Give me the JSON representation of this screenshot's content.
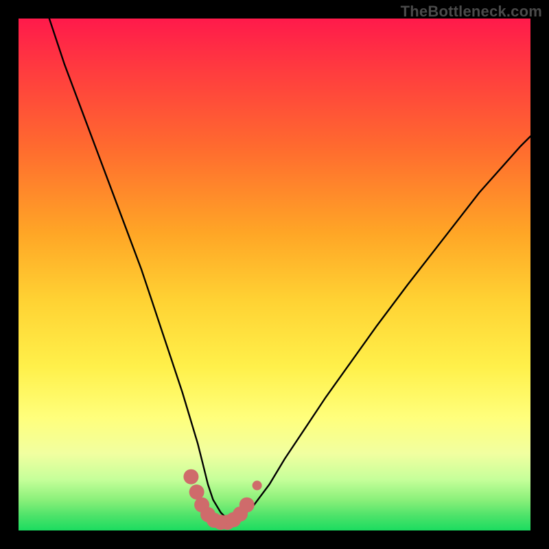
{
  "watermark": "TheBottleneck.com",
  "chart_data": {
    "type": "line",
    "title": "",
    "xlabel": "",
    "ylabel": "",
    "xlim": [
      0,
      100
    ],
    "ylim": [
      0,
      100
    ],
    "series": [
      {
        "name": "bottleneck-curve",
        "x": [
          6,
          9,
          12,
          15,
          18,
          21,
          24,
          26,
          28,
          30,
          32,
          33.5,
          35,
          36,
          37,
          38,
          39.5,
          41,
          42.5,
          44,
          46,
          49,
          52,
          56,
          60,
          65,
          70,
          76,
          83,
          90,
          98,
          100
        ],
        "y": [
          100,
          91,
          83,
          75,
          67,
          59,
          51,
          45,
          39,
          33,
          27,
          22,
          17,
          13,
          9,
          6,
          3.5,
          2,
          2,
          3,
          5,
          9,
          14,
          20,
          26,
          33,
          40,
          48,
          57,
          66,
          75,
          77
        ]
      }
    ],
    "markers": {
      "name": "trough-markers",
      "color": "#cf6b6b",
      "points": [
        {
          "x": 33.7,
          "y": 10.5
        },
        {
          "x": 34.8,
          "y": 7.5
        },
        {
          "x": 35.8,
          "y": 5.0
        },
        {
          "x": 37.0,
          "y": 3.1
        },
        {
          "x": 38.2,
          "y": 2.0
        },
        {
          "x": 39.5,
          "y": 1.6
        },
        {
          "x": 40.8,
          "y": 1.6
        },
        {
          "x": 42.0,
          "y": 2.1
        },
        {
          "x": 43.3,
          "y": 3.2
        },
        {
          "x": 44.6,
          "y": 5.0
        },
        {
          "x": 46.6,
          "y": 8.8
        }
      ]
    }
  }
}
